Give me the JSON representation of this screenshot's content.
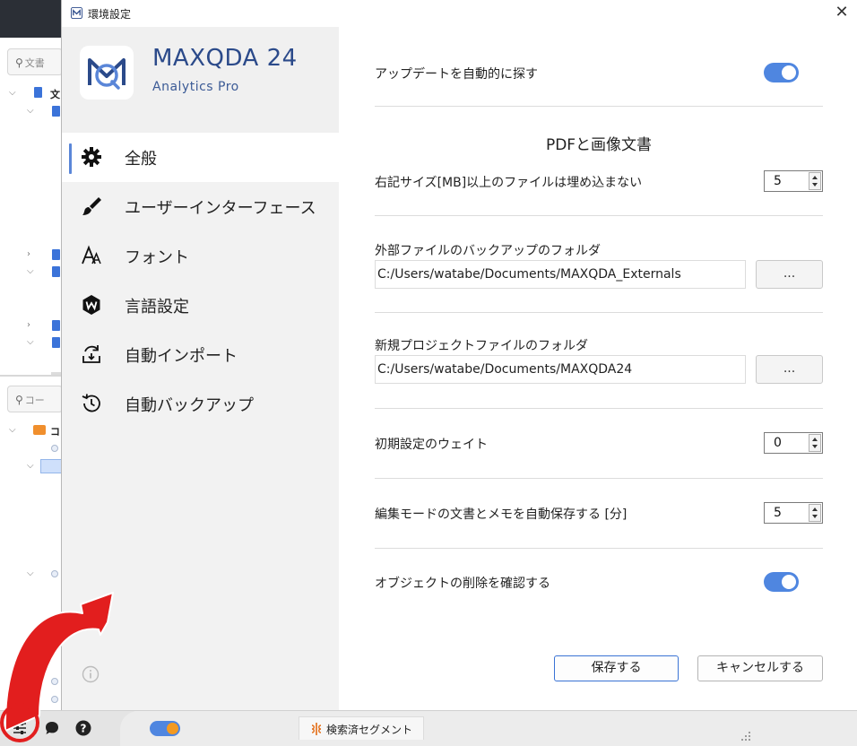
{
  "background": {
    "search_docs_placeholder": "文書",
    "search_codes_placeholder": "コー",
    "doc_root_label": "文",
    "code_root_label": "コ"
  },
  "dialog": {
    "title": "環境設定",
    "close_symbol": "✕"
  },
  "brand": {
    "name": "MAXQDA 24",
    "edition": "Analytics Pro"
  },
  "nav": {
    "items": [
      {
        "label": "全般",
        "icon": "gear-icon",
        "active": true
      },
      {
        "label": "ユーザーインターフェース",
        "icon": "paintbrush-icon",
        "active": false
      },
      {
        "label": "フォント",
        "icon": "font-icon",
        "active": false
      },
      {
        "label": "言語設定",
        "icon": "language-icon",
        "active": false
      },
      {
        "label": "自動インポート",
        "icon": "auto-import-icon",
        "active": false
      },
      {
        "label": "自動バックアップ",
        "icon": "history-icon",
        "active": false
      }
    ]
  },
  "settings": {
    "auto_update_label": "アップデートを自動的に探す",
    "auto_update_on": true,
    "pdf_section_title": "PDFと画像文書",
    "embed_limit_label": "右記サイズ[MB]以上のファイルは埋め込まない",
    "embed_limit_value": "5",
    "externals_folder_label": "外部ファイルのバックアップのフォルダ",
    "externals_folder_value": "C:/Users/watabe/Documents/MAXQDA_Externals",
    "new_project_folder_label": "新規プロジェクトファイルのフォルダ",
    "new_project_folder_value": "C:/Users/watabe/Documents/MAXQDA24",
    "browse_label": "...",
    "default_weight_label": "初期設定のウェイト",
    "default_weight_value": "0",
    "autosave_label": "編集モードの文書とメモを自動保存する [分]",
    "autosave_value": "5",
    "confirm_delete_label": "オブジェクトの削除を確認する",
    "confirm_delete_on": true
  },
  "buttons": {
    "save": "保存する",
    "cancel": "キャンセルする"
  },
  "statusbar": {
    "tab_label": "検索済セグメント"
  },
  "colors": {
    "accent": "#4f86e0",
    "brand": "#2b4a8a",
    "annotation": "#e21e1e",
    "orange": "#f39a22"
  }
}
